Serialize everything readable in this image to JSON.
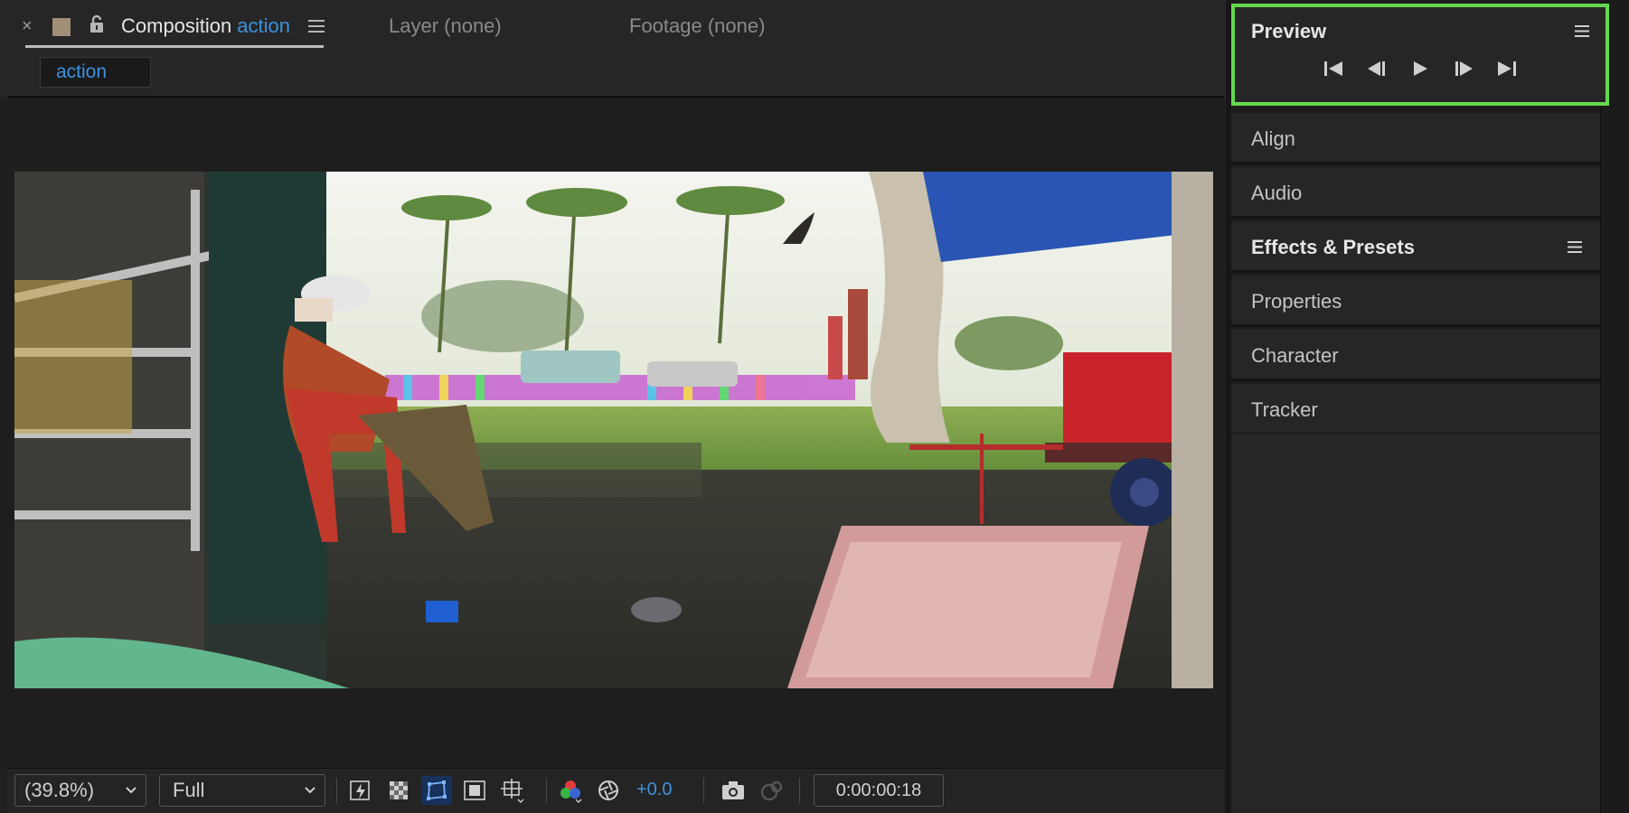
{
  "composition_tab": {
    "close_label": "×",
    "title_prefix": "Composition",
    "comp_name": "action"
  },
  "other_tabs": {
    "layer": "Layer (none)",
    "footage": "Footage (none)"
  },
  "comp_chip": "action",
  "viewer_toolbar": {
    "zoom": "(39.8%)",
    "resolution": "Full",
    "exposure": "+0.0",
    "timecode": "0:00:00:18"
  },
  "preview_panel": {
    "title": "Preview",
    "controls": [
      "first-frame-icon",
      "previous-frame-icon",
      "play-icon",
      "next-frame-icon",
      "last-frame-icon"
    ]
  },
  "panels": [
    {
      "label": "Align",
      "has_menu": false
    },
    {
      "label": "Audio",
      "has_menu": false
    },
    {
      "label": "Effects & Presets",
      "has_menu": true
    },
    {
      "label": "Properties",
      "has_menu": false
    },
    {
      "label": "Character",
      "has_menu": false
    },
    {
      "label": "Tracker",
      "has_menu": false
    }
  ],
  "colors": {
    "accent_blue": "#3e92de",
    "highlight_green": "#65d84d",
    "panel_bg": "#262626"
  }
}
